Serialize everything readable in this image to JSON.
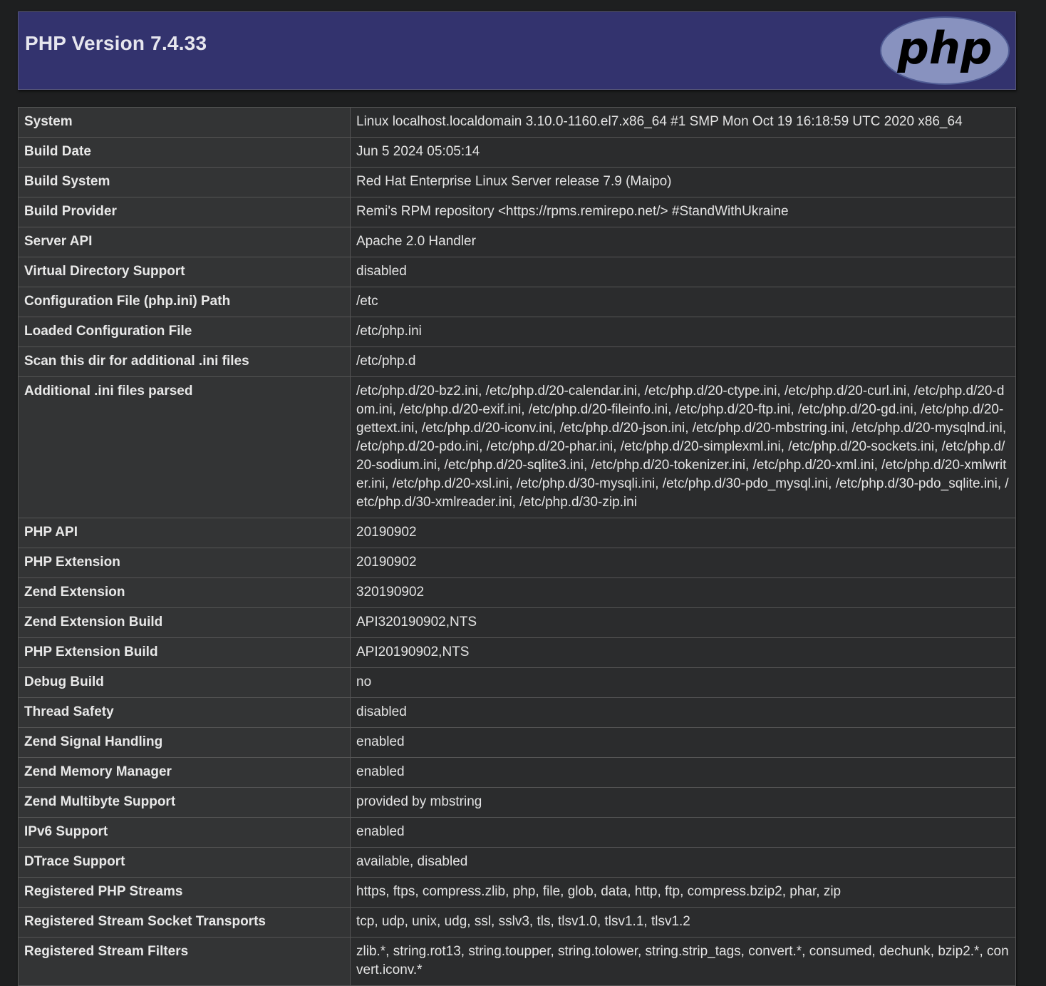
{
  "header": {
    "title": "PHP Version 7.4.33",
    "logo_text": "php",
    "logo_bg": "#8892bf"
  },
  "rows": [
    {
      "key": "System",
      "value": "Linux localhost.localdomain 3.10.0-1160.el7.x86_64 #1 SMP Mon Oct 19 16:18:59 UTC 2020 x86_64"
    },
    {
      "key": "Build Date",
      "value": "Jun 5 2024 05:05:14"
    },
    {
      "key": "Build System",
      "value": "Red Hat Enterprise Linux Server release 7.9 (Maipo)"
    },
    {
      "key": "Build Provider",
      "value": "Remi's RPM repository <https://rpms.remirepo.net/> #StandWithUkraine"
    },
    {
      "key": "Server API",
      "value": "Apache 2.0 Handler"
    },
    {
      "key": "Virtual Directory Support",
      "value": "disabled"
    },
    {
      "key": "Configuration File (php.ini) Path",
      "value": "/etc"
    },
    {
      "key": "Loaded Configuration File",
      "value": "/etc/php.ini"
    },
    {
      "key": "Scan this dir for additional .ini files",
      "value": "/etc/php.d"
    },
    {
      "key": "Additional .ini files parsed",
      "value": "/etc/php.d/20-bz2.ini, /etc/php.d/20-calendar.ini, /etc/php.d/20-ctype.ini, /etc/php.d/20-curl.ini, /etc/php.d/20-dom.ini, /etc/php.d/20-exif.ini, /etc/php.d/20-fileinfo.ini, /etc/php.d/20-ftp.ini, /etc/php.d/20-gd.ini, /etc/php.d/20-gettext.ini, /etc/php.d/20-iconv.ini, /etc/php.d/20-json.ini, /etc/php.d/20-mbstring.ini, /etc/php.d/20-mysqlnd.ini, /etc/php.d/20-pdo.ini, /etc/php.d/20-phar.ini, /etc/php.d/20-simplexml.ini, /etc/php.d/20-sockets.ini, /etc/php.d/20-sodium.ini, /etc/php.d/20-sqlite3.ini, /etc/php.d/20-tokenizer.ini, /etc/php.d/20-xml.ini, /etc/php.d/20-xmlwriter.ini, /etc/php.d/20-xsl.ini, /etc/php.d/30-mysqli.ini, /etc/php.d/30-pdo_mysql.ini, /etc/php.d/30-pdo_sqlite.ini, /etc/php.d/30-xmlreader.ini, /etc/php.d/30-zip.ini"
    },
    {
      "key": "PHP API",
      "value": "20190902"
    },
    {
      "key": "PHP Extension",
      "value": "20190902"
    },
    {
      "key": "Zend Extension",
      "value": "320190902"
    },
    {
      "key": "Zend Extension Build",
      "value": "API320190902,NTS"
    },
    {
      "key": "PHP Extension Build",
      "value": "API20190902,NTS"
    },
    {
      "key": "Debug Build",
      "value": "no"
    },
    {
      "key": "Thread Safety",
      "value": "disabled"
    },
    {
      "key": "Zend Signal Handling",
      "value": "enabled"
    },
    {
      "key": "Zend Memory Manager",
      "value": "enabled"
    },
    {
      "key": "Zend Multibyte Support",
      "value": "provided by mbstring"
    },
    {
      "key": "IPv6 Support",
      "value": "enabled"
    },
    {
      "key": "DTrace Support",
      "value": "available, disabled"
    },
    {
      "key": "Registered PHP Streams",
      "value": "https, ftps, compress.zlib, php, file, glob, data, http, ftp, compress.bzip2, phar, zip"
    },
    {
      "key": "Registered Stream Socket Transports",
      "value": "tcp, udp, unix, udg, ssl, sslv3, tls, tlsv1.0, tlsv1.1, tlsv1.2"
    },
    {
      "key": "Registered Stream Filters",
      "value": "zlib.*, string.rot13, string.toupper, string.tolower, string.strip_tags, convert.*, consumed, dechunk, bzip2.*, convert.iconv.*"
    }
  ]
}
